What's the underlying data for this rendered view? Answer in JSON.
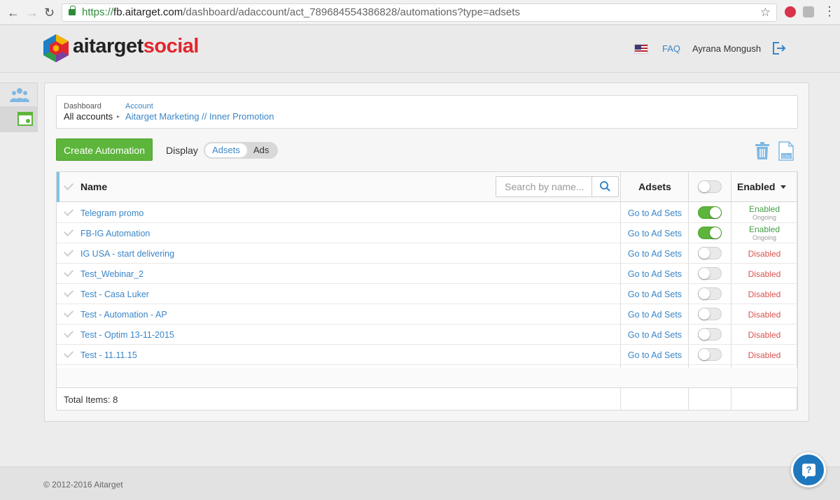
{
  "browser": {
    "back_icon": "←",
    "forward_icon": "→",
    "reload_icon": "↻",
    "url_scheme": "https://",
    "url_host": "fb.aitarget.com",
    "url_path": "/dashboard/adaccount/act_789684554386828/automations?type=adsets",
    "bookmark_icon": "☆",
    "menu_icon": "⋮"
  },
  "header": {
    "logo_part1": "aitarget",
    "logo_part2": "social",
    "faq": "FAQ",
    "user_name": "Ayrana Mongush"
  },
  "breadcrumb": {
    "level1_label": "Dashboard",
    "level1_value": "All accounts",
    "separator": "▸",
    "level2_label": "Account",
    "level2_value": "Aitarget Marketing // Inner Promotion"
  },
  "toolbar": {
    "create_label": "Create Automation",
    "display_label": "Display",
    "display_options": [
      "Adsets",
      "Ads"
    ],
    "display_selected": "Adsets"
  },
  "table": {
    "columns": {
      "name": "Name",
      "adsets": "Adsets",
      "enabled": "Enabled"
    },
    "search_placeholder": "Search by name...",
    "rows": [
      {
        "name": "Telegram promo",
        "link": "Go to Ad Sets",
        "on": true,
        "status": "Enabled",
        "sub": "Ongoing"
      },
      {
        "name": "FB-IG Automation",
        "link": "Go to Ad Sets",
        "on": true,
        "status": "Enabled",
        "sub": "Ongoing"
      },
      {
        "name": "IG USA - start delivering",
        "link": "Go to Ad Sets",
        "on": false,
        "status": "Disabled",
        "sub": ""
      },
      {
        "name": "Test_Webinar_2",
        "link": "Go to Ad Sets",
        "on": false,
        "status": "Disabled",
        "sub": ""
      },
      {
        "name": "Test - Casa Luker",
        "link": "Go to Ad Sets",
        "on": false,
        "status": "Disabled",
        "sub": ""
      },
      {
        "name": "Test - Automation - AP",
        "link": "Go to Ad Sets",
        "on": false,
        "status": "Disabled",
        "sub": ""
      },
      {
        "name": "Test - Optim 13-11-2015",
        "link": "Go to Ad Sets",
        "on": false,
        "status": "Disabled",
        "sub": ""
      },
      {
        "name": "Test - 11.11.15",
        "link": "Go to Ad Sets",
        "on": false,
        "status": "Disabled",
        "sub": ""
      }
    ],
    "total_label": "Total Items: 8"
  },
  "footer": {
    "copyright": "© 2012-2016 Aitarget",
    "help_icon": "?"
  },
  "colors": {
    "accent_blue": "#3a86c8",
    "create_green": "#5db53b",
    "enabled_green": "#43a047",
    "disabled_red": "#d9534f",
    "brand_red": "#e2262d",
    "help_blue": "#1f78be"
  },
  "icons": [
    "lock-icon",
    "star-icon",
    "extension-icon",
    "menu-icon",
    "logo-icon",
    "flag-us-icon",
    "logout-icon",
    "users-icon",
    "automation-window-icon",
    "trash-icon",
    "csv-icon",
    "search-icon",
    "check-icon",
    "help-icon"
  ]
}
